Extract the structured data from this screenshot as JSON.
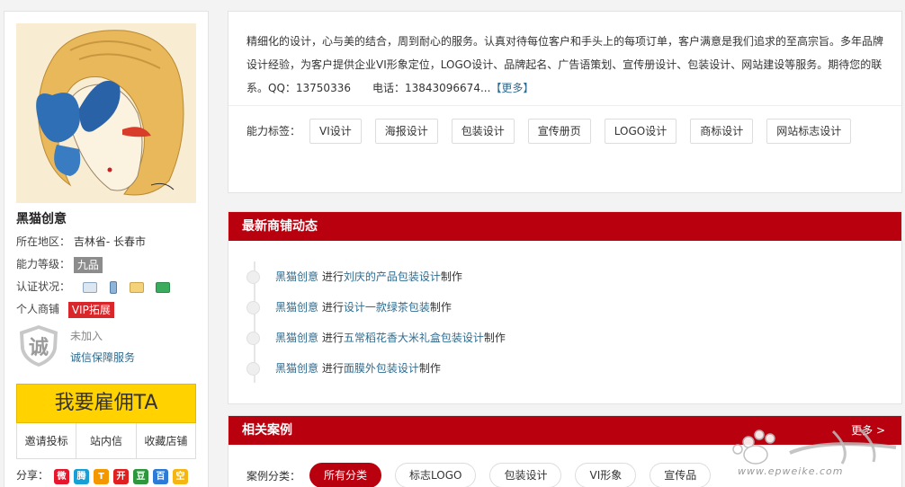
{
  "profile": {
    "shop_name": "黑猫创意",
    "region_label": "所在地区：",
    "region_value": "吉林省- 长春市",
    "level_label": "能力等级：",
    "level_value": "九品",
    "cert_label": "认证状况：",
    "shop_type_label": "个人商铺",
    "vip_label": "VIP拓展",
    "shield_char": "诚",
    "not_joined": "未加入",
    "trust_service": "诚信保障服务",
    "hire_button": "我要雇佣TA",
    "actions": [
      "邀请投标",
      "站内信",
      "收藏店铺"
    ],
    "share_label": "分享：",
    "share_icons": [
      {
        "name": "weibo-icon",
        "glyph": "微",
        "color": "#e6162d"
      },
      {
        "name": "tencent-weibo-icon",
        "glyph": "腾",
        "color": "#18a0d6"
      },
      {
        "name": "renren-icon",
        "glyph": "T",
        "color": "#f39800"
      },
      {
        "name": "kaixin-icon",
        "glyph": "开",
        "color": "#e02020"
      },
      {
        "name": "douban-icon",
        "glyph": "豆",
        "color": "#2e963d"
      },
      {
        "name": "baidu-icon",
        "glyph": "百",
        "color": "#2d7bd6"
      },
      {
        "name": "qzone-icon",
        "glyph": "空",
        "color": "#f5b614"
      }
    ]
  },
  "description": {
    "text": "精细化的设计，心与美的结合，周到耐心的服务。认真对待每位客户和手头上的每项订单，客户满意是我们追求的至高宗旨。多年品牌设计经验，为客户提供企业VI形象定位，LOGO设计、品牌起名、广告语策划、宣传册设计、包装设计、网站建设等服务。期待您的联系。QQ：13750336　　电话：13843096674...",
    "more": "【更多】",
    "tags_label": "能力标签：",
    "tags": [
      "VI设计",
      "海报设计",
      "包装设计",
      "宣传册页",
      "LOGO设计",
      "商标设计",
      "网站标志设计"
    ]
  },
  "activity": {
    "title": "最新商铺动态",
    "items": [
      {
        "user": "黑猫创意",
        "verb": "进行",
        "project": "刘庆的产品包装设计",
        "suffix": "制作"
      },
      {
        "user": "黑猫创意",
        "verb": "进行",
        "project": "设计一款绿茶包装",
        "suffix": "制作"
      },
      {
        "user": "黑猫创意",
        "verb": "进行",
        "project": "五常稻花香大米礼盒包装设计",
        "suffix": "制作"
      },
      {
        "user": "黑猫创意",
        "verb": "进行",
        "project": "面膜外包装设计",
        "suffix": "制作"
      }
    ]
  },
  "cases": {
    "title": "相关案例",
    "more": "更多 >",
    "filter_label": "案例分类：",
    "filters": [
      "所有分类",
      "标志LOGO",
      "包装设计",
      "VI形象",
      "宣传品"
    ],
    "active_filter": 0
  },
  "watermark": {
    "url": "www.epweike.com"
  },
  "colors": {
    "brand_red": "#b8000e",
    "hire_yellow": "#ffd200",
    "link_blue": "#2f6b8e"
  }
}
